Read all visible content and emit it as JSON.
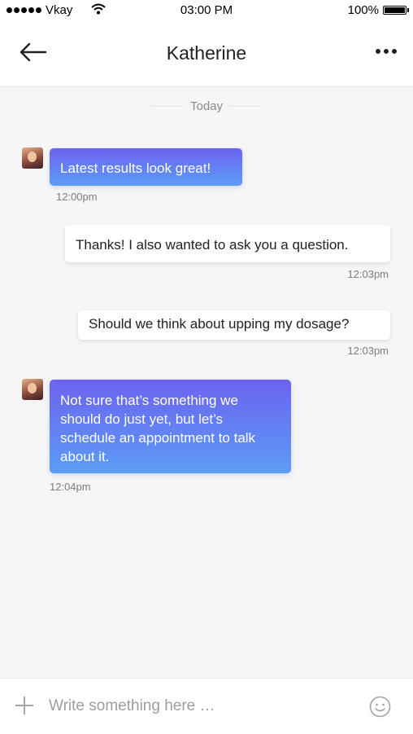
{
  "status_bar": {
    "carrier": "Vkay",
    "time": "03:00 PM",
    "battery": "100%"
  },
  "header": {
    "title": "Katherine"
  },
  "date_separator": "Today",
  "messages": [
    {
      "direction": "incoming",
      "text": "Latest results look great!",
      "time": "12:00pm"
    },
    {
      "direction": "outgoing",
      "text": "Thanks! I also wanted to ask you a question.",
      "time": "12:03pm"
    },
    {
      "direction": "outgoing",
      "text": "Should we think about upping my dosage?",
      "time": "12:03pm"
    },
    {
      "direction": "incoming",
      "text": "Not sure that’s something we should do just yet, but let’s schedule an appointment to talk about it.",
      "time": "12:04pm"
    }
  ],
  "composer": {
    "placeholder": "Write something here …",
    "value": ""
  },
  "icons": {
    "back": "arrow-left-icon",
    "more": "more-horizontal-icon",
    "attach": "plus-icon",
    "emoji": "smiley-icon"
  },
  "colors": {
    "incoming_gradient_start": "#6c63f0",
    "incoming_gradient_end": "#5b9cf5",
    "background": "#f6f6f7"
  }
}
